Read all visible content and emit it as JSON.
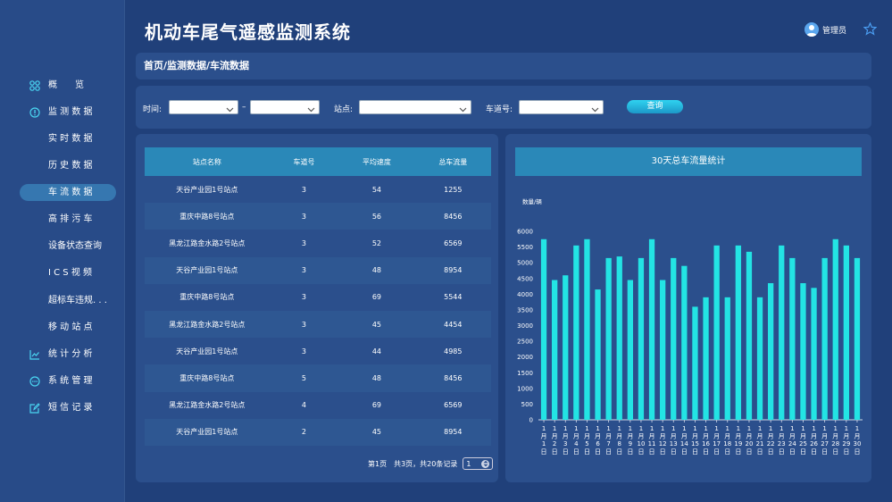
{
  "header": {
    "title": "机动车尾气遥感监测系统",
    "user_name": "管理员"
  },
  "sidebar": {
    "items": [
      {
        "label": "概　　览",
        "icon": "overview-icon",
        "level": "top",
        "active": false
      },
      {
        "label": "监 测 数 据",
        "icon": "monitor-icon",
        "level": "top",
        "active": false
      },
      {
        "label": "实 时 数 据",
        "level": "sub",
        "active": false
      },
      {
        "label": "历 史 数 据",
        "level": "sub",
        "active": false
      },
      {
        "label": "车 流 数 据",
        "level": "sub",
        "active": true
      },
      {
        "label": "高 排 污 车",
        "level": "sub",
        "active": false
      },
      {
        "label": "设备状态查询",
        "level": "sub",
        "active": false
      },
      {
        "label": "I C S 视 频",
        "level": "sub",
        "active": false
      },
      {
        "label": "超标车违规. . .",
        "level": "sub",
        "active": false
      },
      {
        "label": "移 动 站 点",
        "level": "sub",
        "active": false
      },
      {
        "label": "统 计 分 析",
        "icon": "stats-icon",
        "level": "top",
        "active": false
      },
      {
        "label": "系 统 管 理",
        "icon": "system-icon",
        "level": "top",
        "active": false
      },
      {
        "label": "短 信 记 录",
        "icon": "sms-icon",
        "level": "top",
        "active": false
      }
    ]
  },
  "breadcrumb": "首页/监测数据/车流数据",
  "filter": {
    "time_label": "时间:",
    "dash": "–",
    "station_label": "站点:",
    "lane_label": "车道号:",
    "query_label": "查询"
  },
  "table": {
    "headers": [
      "站点名称",
      "车道号",
      "平均速度",
      "总车流量"
    ],
    "rows": [
      [
        "天谷产业园1号站点",
        "3",
        "54",
        "1255"
      ],
      [
        "重庆中路8号站点",
        "3",
        "56",
        "8456"
      ],
      [
        "黑龙江路金水路2号站点",
        "3",
        "52",
        "6569"
      ],
      [
        "天谷产业园1号站点",
        "3",
        "48",
        "8954"
      ],
      [
        "重庆中路8号站点",
        "3",
        "69",
        "5544"
      ],
      [
        "黑龙江路金水路2号站点",
        "3",
        "45",
        "4454"
      ],
      [
        "天谷产业园1号站点",
        "3",
        "44",
        "4985"
      ],
      [
        "重庆中路8号站点",
        "5",
        "48",
        "8456"
      ],
      [
        "黑龙江路金水路2号站点",
        "4",
        "69",
        "6569"
      ],
      [
        "天谷产业园1号站点",
        "2",
        "45",
        "8954"
      ]
    ]
  },
  "pagination": {
    "summary": "第1页　共3页，共20条记录",
    "page_value": "1"
  },
  "chart_data": {
    "type": "bar",
    "title": "30天总车流量统计",
    "ylabel": "数量/辆",
    "ylim": [
      0,
      6000
    ],
    "yticks": [
      0,
      500,
      1000,
      1500,
      2000,
      2500,
      3000,
      3500,
      4000,
      4500,
      5000,
      5500,
      6000
    ],
    "categories": [
      "1月1日",
      "1月2日",
      "1月3日",
      "1月4日",
      "1月5日",
      "1月6日",
      "1月7日",
      "1月8日",
      "1月9日",
      "1月10日",
      "1月11日",
      "1月12日",
      "1月13日",
      "1月14日",
      "1月15日",
      "1月16日",
      "1月17日",
      "1月18日",
      "1月19日",
      "1月20日",
      "1月21日",
      "1月22日",
      "1月23日",
      "1月24日",
      "1月25日",
      "1月26日",
      "1月27日",
      "1月28日",
      "1月29日",
      "1月30日"
    ],
    "values": [
      5750,
      4450,
      4600,
      5550,
      5750,
      4150,
      5150,
      5200,
      4450,
      5150,
      5750,
      4450,
      5150,
      4900,
      3600,
      3900,
      5550,
      3900,
      5550,
      5350,
      3900,
      4350,
      5550,
      5150,
      4350,
      4200,
      5150,
      5750,
      5550,
      5150
    ],
    "color": "#23e4e4"
  }
}
